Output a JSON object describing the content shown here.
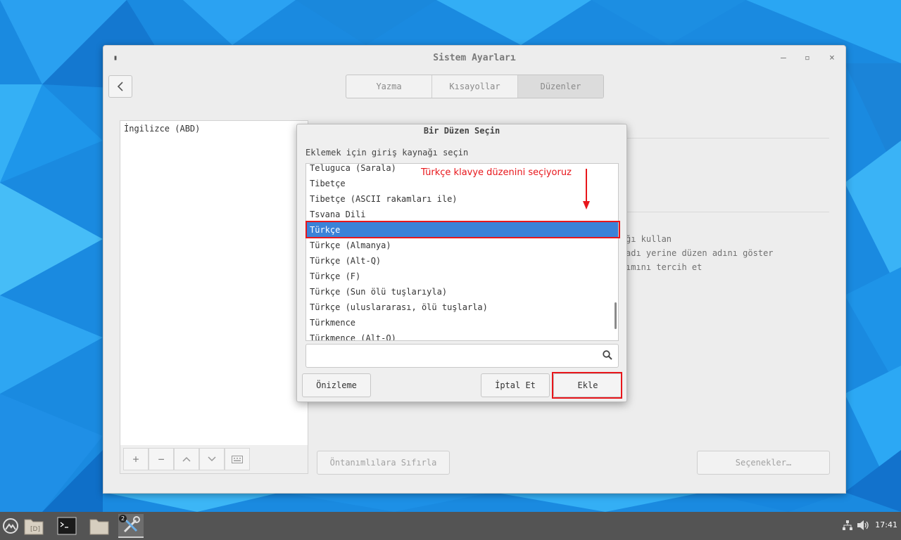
{
  "window": {
    "title": "Sistem Ayarları",
    "menu_glyph": "▮",
    "minimize_glyph": "–",
    "maximize_glyph": "▫",
    "close_glyph": "×",
    "back_icon": "chevron-left-icon",
    "tabs": [
      {
        "label": "Yazma",
        "active": false
      },
      {
        "label": "Kısayollar",
        "active": false
      },
      {
        "label": "Düzenler",
        "active": true
      }
    ],
    "layouts": [
      "İngilizce (ABD)"
    ],
    "toolbar": {
      "add": "+",
      "remove": "−",
      "up": "︿",
      "down": "﹀",
      "keyboard_icon": "keyboard-icon"
    },
    "behind_lines": [
      "ğı kullan",
      "adı yerine düzen adını göster",
      "ımını tercih et"
    ],
    "reset_label": "Öntanımlılara Sıfırla",
    "options_label": "Seçenekler…"
  },
  "dialog": {
    "title": "Bir Düzen Seçin",
    "prompt": "Eklemek için giriş kaynağı seçin",
    "items": [
      "Teluguca (Sarala)",
      "Tibetçe",
      "Tibetçe (ASCII rakamları ile)",
      "Tsvana Dili",
      "Türkçe",
      "Türkçe (Almanya)",
      "Türkçe (Alt-Q)",
      "Türkçe (F)",
      "Türkçe (Sun ölü tuşlarıyla)",
      "Türkçe (uluslararası, ölü tuşlarla)",
      "Türkmence",
      "Türkmence (Alt-Q)"
    ],
    "selected_index": 4,
    "search_value": "",
    "search_icon": "search-icon",
    "preview_label": "Önizleme",
    "cancel_label": "İptal Et",
    "add_label": "Ekle"
  },
  "annotation": {
    "text": "Türkçe klavye düzenini seçiyoruz",
    "color": "#e8161b"
  },
  "taskbar": {
    "badge_count": "2",
    "clock": "17:41",
    "icons": [
      "start-menu-icon",
      "file-manager-icon",
      "terminal-icon",
      "folder-icon",
      "settings-tools-icon"
    ]
  },
  "colors": {
    "selection": "#3b82d8",
    "wallpaper": "#1f8fe0",
    "taskbar": "#545454"
  }
}
